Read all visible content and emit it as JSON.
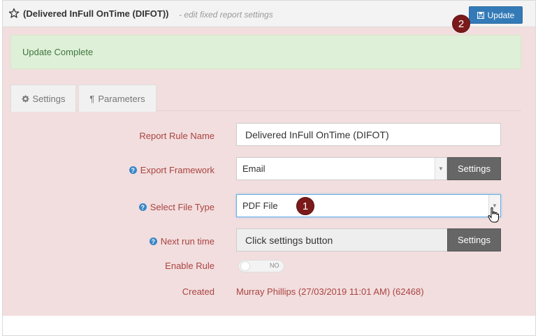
{
  "header": {
    "title": "(Delivered InFull OnTime (DIFOT))",
    "subtitle": "- edit fixed report settings",
    "update_label": "Update",
    "icons": {
      "favorite": "star-outline-icon",
      "save": "floppy-disk-icon"
    }
  },
  "annotations": {
    "badge1": "1",
    "badge2": "2",
    "badge_color": "#7b1a1a"
  },
  "alert": {
    "text": "Update Complete"
  },
  "tabs": [
    {
      "label": "Settings",
      "icon": "gear-icon"
    },
    {
      "label": "Parameters",
      "icon": "pilcrow-icon"
    }
  ],
  "form": {
    "report_rule_name": {
      "label": "Report Rule Name",
      "value": "Delivered InFull OnTime (DIFOT)"
    },
    "export_framework": {
      "label": "Export Framework",
      "value": "Email",
      "button": "Settings"
    },
    "file_type": {
      "label": "Select File Type",
      "value": "PDF File"
    },
    "next_run": {
      "label": "Next run time",
      "value": "Click settings button",
      "button": "Settings"
    },
    "enable_rule": {
      "label": "Enable Rule",
      "state": "NO"
    },
    "created": {
      "label": "Created",
      "value": "Murray Phillips (27/03/2019 11:01 AM) (62468)"
    }
  },
  "colors": {
    "primary": "#337ab7",
    "panel_bg": "#f2dede",
    "label": "#a94442",
    "success_bg": "#dff0d8"
  }
}
